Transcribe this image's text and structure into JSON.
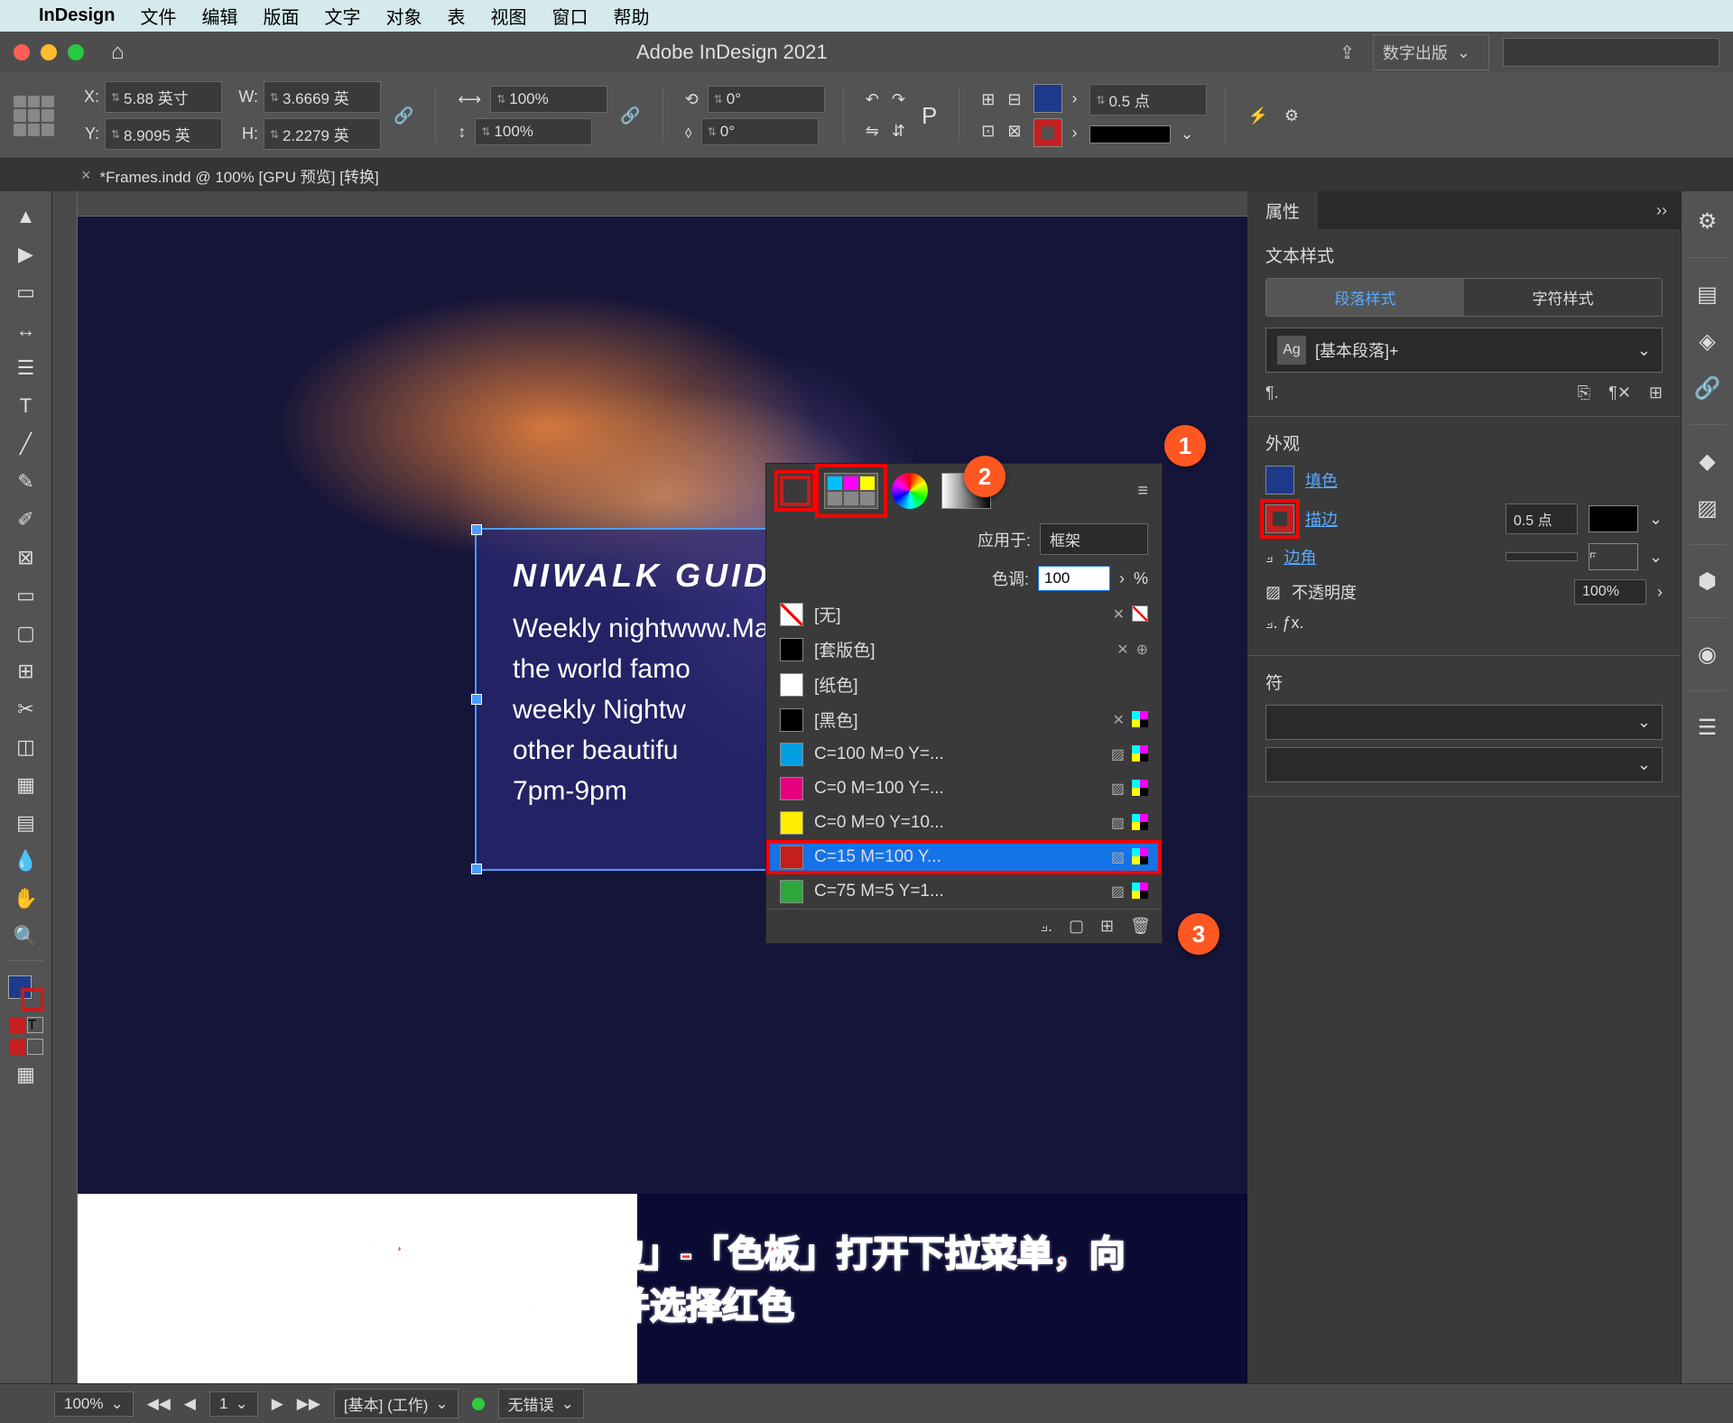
{
  "mac_menu": {
    "app_name": "InDesign",
    "items": [
      "文件",
      "编辑",
      "版面",
      "文字",
      "对象",
      "表",
      "视图",
      "窗口",
      "帮助"
    ]
  },
  "titlebar": {
    "app_title": "Adobe InDesign 2021",
    "workspace": "数字出版"
  },
  "control_bar": {
    "x_label": "X:",
    "x_value": "5.88 英寸",
    "y_label": "Y:",
    "y_value": "8.9095 英",
    "w_label": "W:",
    "w_value": "3.6669 英",
    "h_label": "H:",
    "h_value": "2.2279 英",
    "scale_x": "100%",
    "scale_y": "100%",
    "rotate": "0°",
    "shear": "0°",
    "stroke_weight": "0.5 点"
  },
  "document_tab": {
    "name": "*Frames.indd @ 100% [GPU 预览] [转换]"
  },
  "text_frame": {
    "title": "NIWALK GUIDE",
    "body_l1": "Weekly nightwww.MacZ.com",
    "body_l2": "the world famo",
    "body_l3": "weekly Nightw",
    "body_l4": "other beautifu",
    "body_l5": "7pm-9pm"
  },
  "swatches_popup": {
    "apply_to_label": "应用于:",
    "apply_to_value": "框架",
    "tint_label": "色调:",
    "tint_value": "100",
    "tint_unit": "%",
    "swatches": [
      {
        "name": "[无]",
        "color": "none",
        "selected": false
      },
      {
        "name": "[套版色]",
        "color": "#000",
        "selected": false
      },
      {
        "name": "[纸色]",
        "color": "#fff",
        "selected": false
      },
      {
        "name": "[黑色]",
        "color": "#000",
        "selected": false
      },
      {
        "name": "C=100 M=0 Y=...",
        "color": "#00a0e0",
        "selected": false
      },
      {
        "name": "C=0 M=100 Y=...",
        "color": "#e6007e",
        "selected": false
      },
      {
        "name": "C=0 M=0 Y=10...",
        "color": "#ffed00",
        "selected": false
      },
      {
        "name": "C=15 M=100 Y...",
        "color": "#c41e1e",
        "selected": true
      },
      {
        "name": "C=75 M=5 Y=1...",
        "color": "#2aa83c",
        "selected": false
      }
    ]
  },
  "badges": {
    "b1": "1",
    "b2": "2",
    "b3": "3"
  },
  "properties_panel": {
    "tab_title": "属性",
    "section_text_style": "文本样式",
    "tab_paragraph": "段落样式",
    "tab_character": "字符样式",
    "style_name": "[基本段落]+",
    "section_appearance": "外观",
    "fill_label": "填色",
    "stroke_label": "描边",
    "stroke_weight": "0.5 点",
    "corner_label": "边角",
    "opacity_label": "不透明度",
    "opacity_value": "100%",
    "section_char": "符"
  },
  "status_bar": {
    "zoom": "100%",
    "page": "1",
    "preset": "[基本] (工作)",
    "errors": "无错误"
  },
  "instruction": "在「属性」面板中点击「描边」-「色板」打开下拉菜单，向下滚动并选择红色"
}
